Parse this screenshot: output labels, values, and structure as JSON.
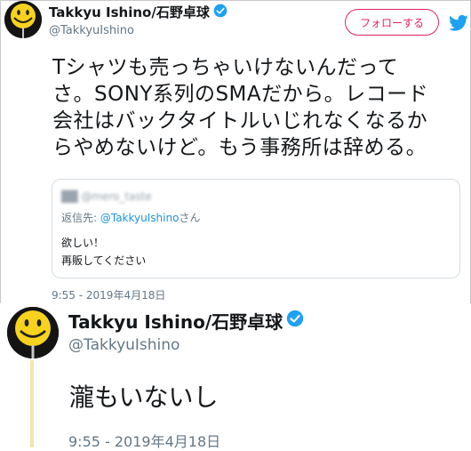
{
  "tweet1": {
    "display_name": "Takkyu Ishino/石野卓球",
    "handle": "@TakkyuIshino",
    "follow_label": "フォローする",
    "text_lines": [
      "Tシャツも売っちゃいけないんだって",
      "さ。SONY系列のSMAだから。レコード",
      "会社はバックタイトルいじれなくなるか",
      "らやめないけど。もう事務所は辞める。"
    ],
    "quote": {
      "blurred_name": "██ @mero_taste",
      "reply_prefix": "返信先: ",
      "reply_mention": "@TakkyuIshino",
      "reply_suffix": "さん",
      "lines": [
        "欲しい！",
        "再販してください"
      ]
    },
    "timestamp": "9:55 - 2019年4月18日"
  },
  "tweet2": {
    "display_name": "Takkyu Ishino/石野卓球",
    "handle": "@TakkyuIshino",
    "text": "瀧もいないし",
    "timestamp": "9:55 - 2019年4月18日"
  },
  "colors": {
    "follow_accent": "#e0245e",
    "verified": "#1da1f2",
    "twitter_blue": "#1da1f2",
    "secondary_text": "#657786",
    "thread_line": "#f0e7a7",
    "avatar_face": "#f7d21e"
  },
  "icons": [
    "smiley-avatar",
    "verified-badge",
    "twitter-bird"
  ]
}
